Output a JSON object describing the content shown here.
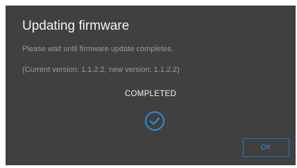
{
  "dialog": {
    "title": "Updating firmware",
    "message": "Please wait until firmware update completes.",
    "version_info": "(Current version: 1.1.2.2, new version: 1.1.2.2)",
    "status": "COMPLETED",
    "status_icon": "check-circle-icon",
    "ok_label": "OK"
  },
  "colors": {
    "dialog_background": "#404040",
    "accent": "#2f8de0",
    "title_text": "#f4f4f4",
    "secondary_text": "#9a9a9a"
  }
}
